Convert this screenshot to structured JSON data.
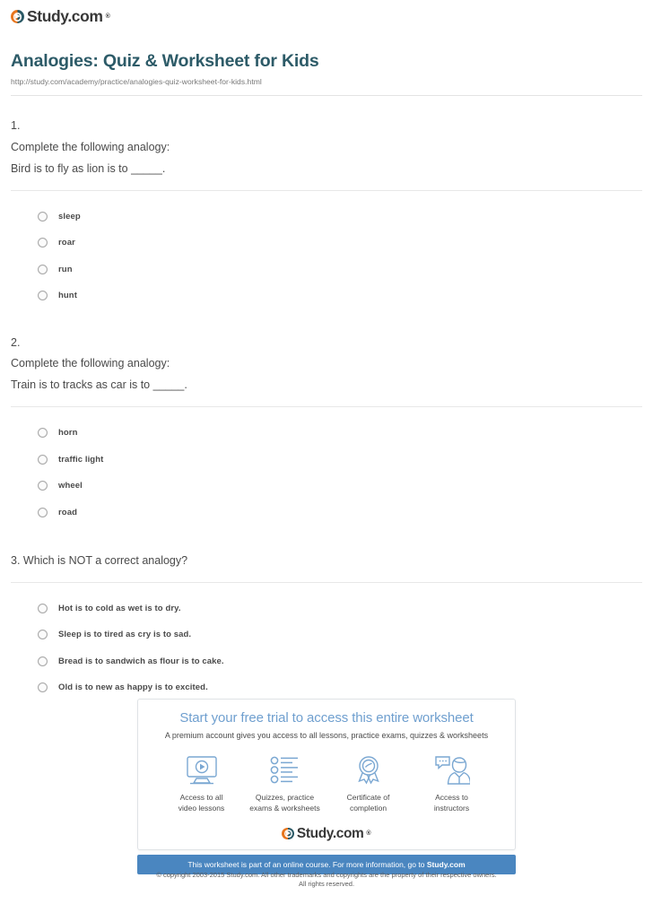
{
  "brand": {
    "name": "Study.com",
    "trademark": "®",
    "logo_colors": {
      "left": "#e8761e",
      "right": "#2c5a66"
    }
  },
  "header": {
    "title": "Analogies: Quiz & Worksheet for Kids",
    "url": "http://study.com/academy/practice/analogies-quiz-worksheet-for-kids.html",
    "title_color": "#2d5b68"
  },
  "questions": [
    {
      "number": "1.",
      "prompt": "Complete the following analogy:",
      "stem": "Bird is to fly as lion is to _____.",
      "options": [
        "sleep",
        "roar",
        "run",
        "hunt"
      ]
    },
    {
      "number": "2.",
      "prompt": "Complete the following analogy:",
      "stem": "Train is to tracks as car is to _____.",
      "options": [
        "horn",
        "traffic light",
        "wheel",
        "road"
      ]
    },
    {
      "number": "3. Which is NOT a correct analogy?",
      "prompt": "",
      "stem": "",
      "options": [
        "Hot is to cold as wet is to dry.",
        "Sleep is to tired as cry is to sad.",
        "Bread is to sandwich as flour is to cake.",
        "Old is to new as happy is to excited."
      ]
    }
  ],
  "promo": {
    "title": "Start your free trial to access this entire worksheet",
    "subtitle": "A premium account gives you access to all lessons, practice exams, quizzes & worksheets",
    "title_color": "#6f9fcf",
    "features": [
      {
        "icon": "video-monitor-icon",
        "label_line1": "Access to all",
        "label_line2": "video lessons"
      },
      {
        "icon": "checklist-icon",
        "label_line1": "Quizzes, practice",
        "label_line2": "exams & worksheets"
      },
      {
        "icon": "award-ribbon-icon",
        "label_line1": "Certificate of",
        "label_line2": "completion"
      },
      {
        "icon": "instructor-chat-icon",
        "label_line1": "Access to",
        "label_line2": "instructors"
      }
    ],
    "bar_text_prefix": "This worksheet is part of an online course. For more information, go to ",
    "bar_text_link": "Study.com",
    "bar_color": "#4a86c0"
  },
  "footer": {
    "line1": "© copyright 2003-2015 Study.com. All other trademarks and copyrights are the property of their respective owners.",
    "line2": "All rights reserved."
  }
}
